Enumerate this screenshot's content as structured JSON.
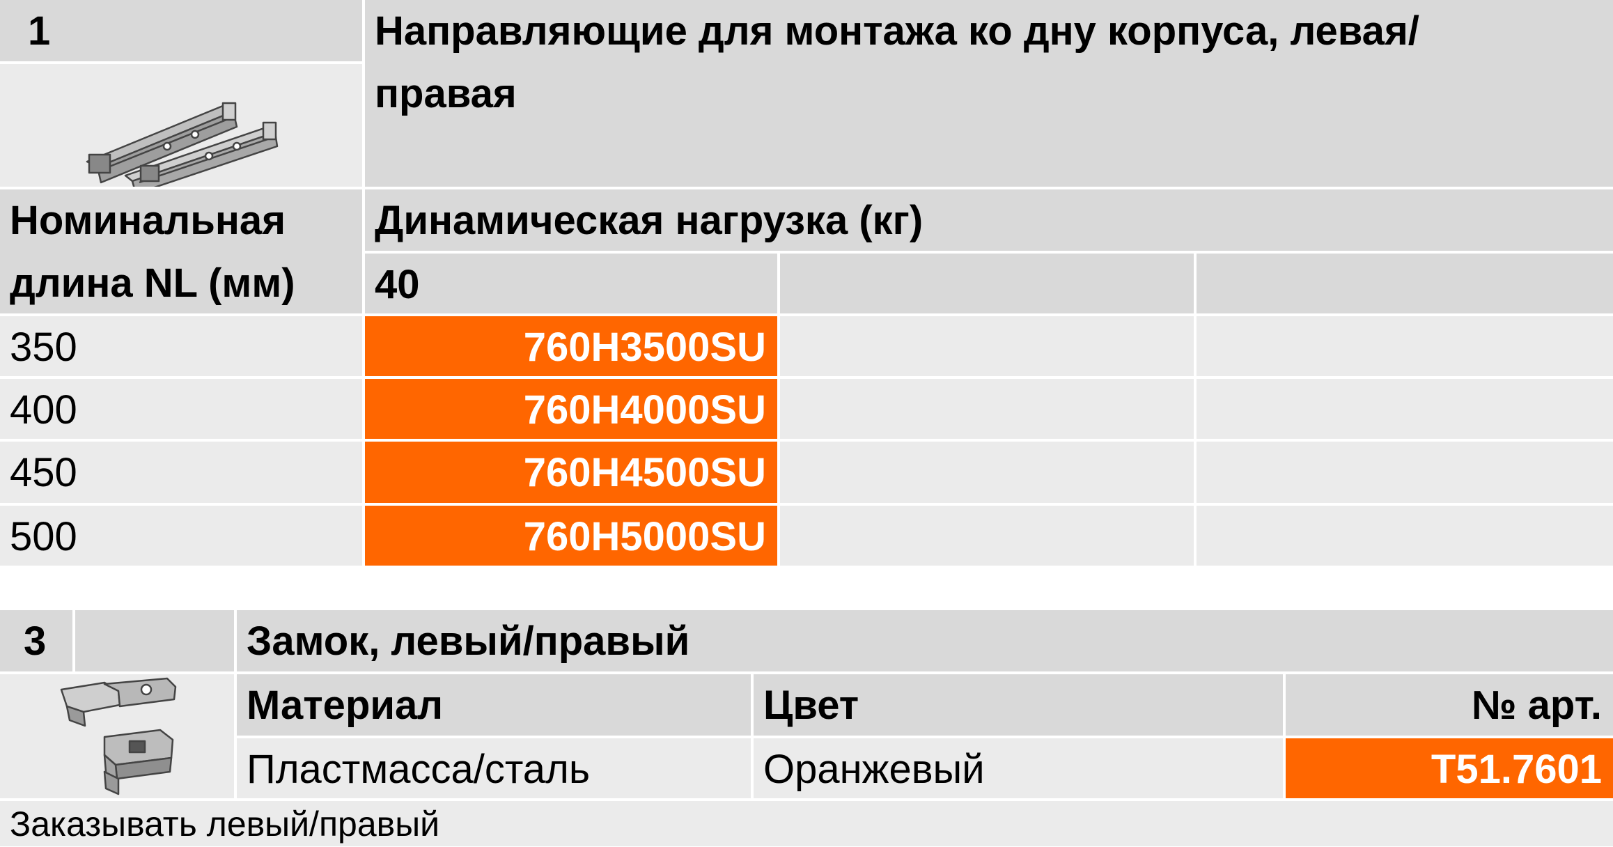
{
  "section1": {
    "number": "1",
    "title_line1": "Направляющие для монтажа ко дну корпуса, левая/",
    "title_line2": "правая",
    "image": "drawer-runner-rail-image",
    "nominal_length_header_line1": "Номинальная",
    "nominal_length_header_line2": "длина NL (мм)",
    "load_header": "Динамическая нагрузка (кг)",
    "load_values": [
      "40",
      "",
      ""
    ],
    "rows": [
      {
        "length": "350",
        "article": "760H3500SU"
      },
      {
        "length": "400",
        "article": "760H4000SU"
      },
      {
        "length": "450",
        "article": "760H4500SU"
      },
      {
        "length": "500",
        "article": "760H5000SU"
      }
    ]
  },
  "section3": {
    "number": "3",
    "title": "Замок, левый/правый",
    "image": "lock-clip-image",
    "headers": {
      "material": "Материал",
      "color": "Цвет",
      "article": "№ арт."
    },
    "row": {
      "material": "Пластмасса/сталь",
      "color": "Оранжевый",
      "article": "T51.7601"
    },
    "footnote": "Заказывать левый/правый"
  },
  "colors": {
    "highlight": "#ff6600",
    "header_gray": "#d9d9d9",
    "cell_gray": "#ebebeb"
  }
}
